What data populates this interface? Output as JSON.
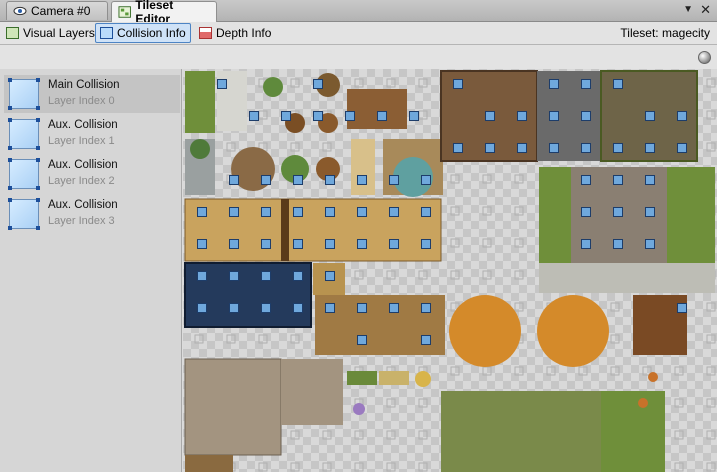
{
  "tabs": [
    {
      "label": "Camera #0",
      "icon": "eye-icon",
      "active": false
    },
    {
      "label": "Tileset Editor",
      "icon": "tileset-icon",
      "active": true
    }
  ],
  "toolbar": {
    "visual_layers": "Visual Layers",
    "collision_info": "Collision Info",
    "depth_info": "Depth Info",
    "tileset_label": "Tileset: magecity"
  },
  "layers": [
    {
      "name": "Main Collision",
      "index": "Layer Index 0",
      "selected": true
    },
    {
      "name": "Aux. Collision",
      "index": "Layer Index 1",
      "selected": false
    },
    {
      "name": "Aux. Collision",
      "index": "Layer Index 2",
      "selected": false
    },
    {
      "name": "Aux. Collision",
      "index": "Layer Index 3",
      "selected": false
    }
  ],
  "colors": {
    "accent": "#4d84c4",
    "collision_marker": "#6fa8dc",
    "wall": "#c9a35e",
    "water": "#243a5c",
    "grass": "#6f8f3a",
    "autumn_tree": "#d48a2a"
  }
}
